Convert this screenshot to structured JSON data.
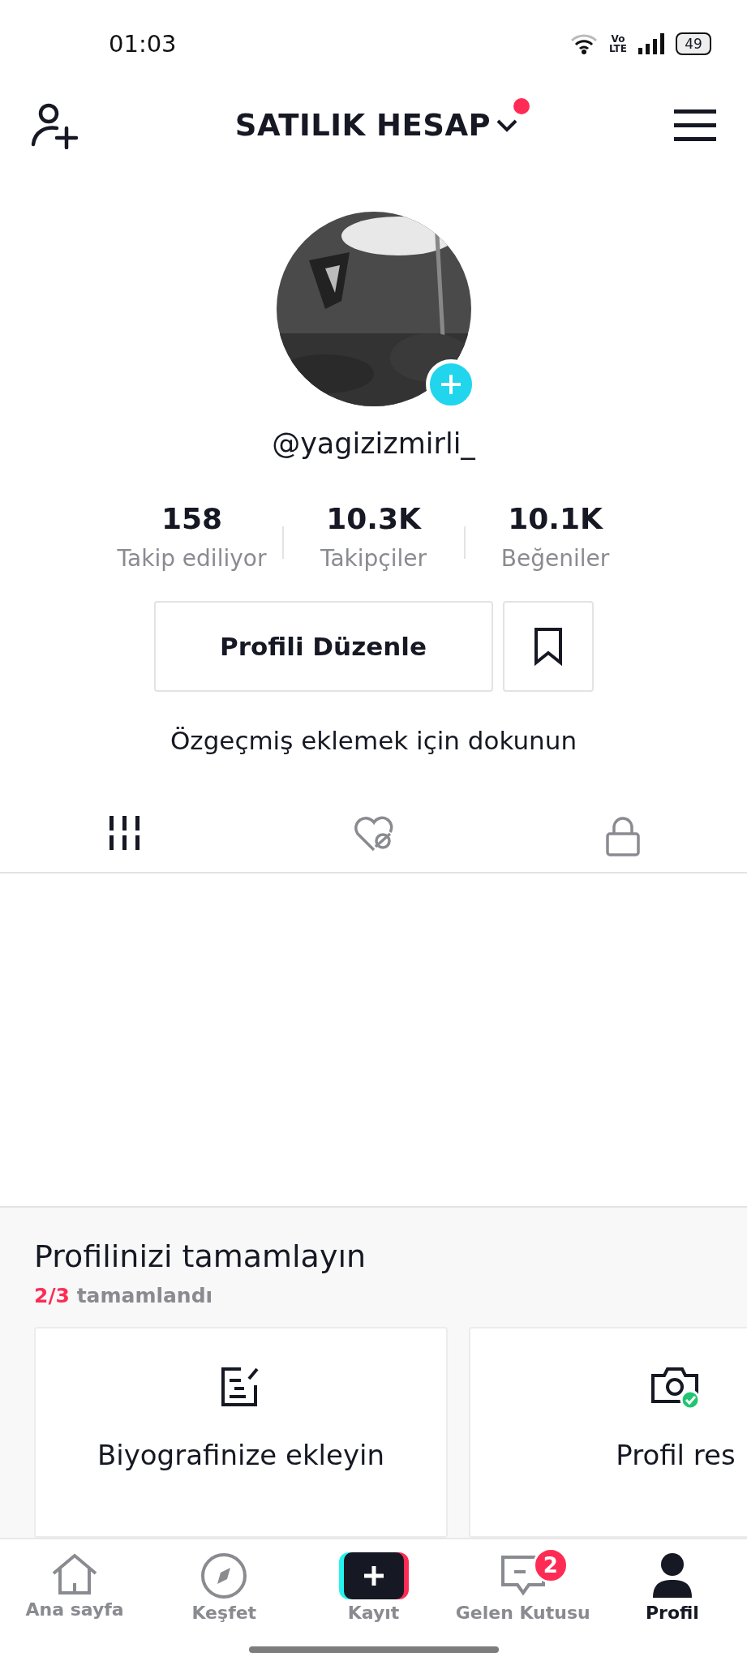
{
  "status_bar": {
    "time": "01:03",
    "lte": "Vo\nLTE",
    "battery": "49"
  },
  "header": {
    "title": "SATILIK HESAP",
    "has_notification": true
  },
  "profile": {
    "username": "@yagizizmirli_"
  },
  "stats": [
    {
      "value": "158",
      "label": "Takip ediliyor"
    },
    {
      "value": "10.3K",
      "label": "Takipçiler"
    },
    {
      "value": "10.1K",
      "label": "Beğeniler"
    }
  ],
  "edit_button": "Profili Düzenle",
  "bio_prompt": "Özgeçmiş eklemek için dokunun",
  "tabs": [
    {
      "kind": "grid",
      "selected": true
    },
    {
      "kind": "liked",
      "selected": false
    },
    {
      "kind": "private",
      "selected": false
    }
  ],
  "complete": {
    "title": "Profilinizi tamamlayın",
    "progress": "2/3",
    "progress_label": "tamamlandı",
    "cards": [
      {
        "kind": "bio",
        "title": "Biyografinize ekleyin",
        "done": false
      },
      {
        "title": "Profil res",
        "done": true
      }
    ]
  },
  "nav": [
    {
      "kind": "home",
      "label": "Ana sayfa",
      "selected": false
    },
    {
      "kind": "explore",
      "label": "Keşfet",
      "selected": false
    },
    {
      "kind": "create",
      "label": "Kayıt",
      "selected": false
    },
    {
      "kind": "inbox",
      "label": "Gelen Kutusu",
      "selected": false,
      "badge": "2"
    },
    {
      "kind": "profile",
      "label": "Profil",
      "selected": true
    }
  ]
}
